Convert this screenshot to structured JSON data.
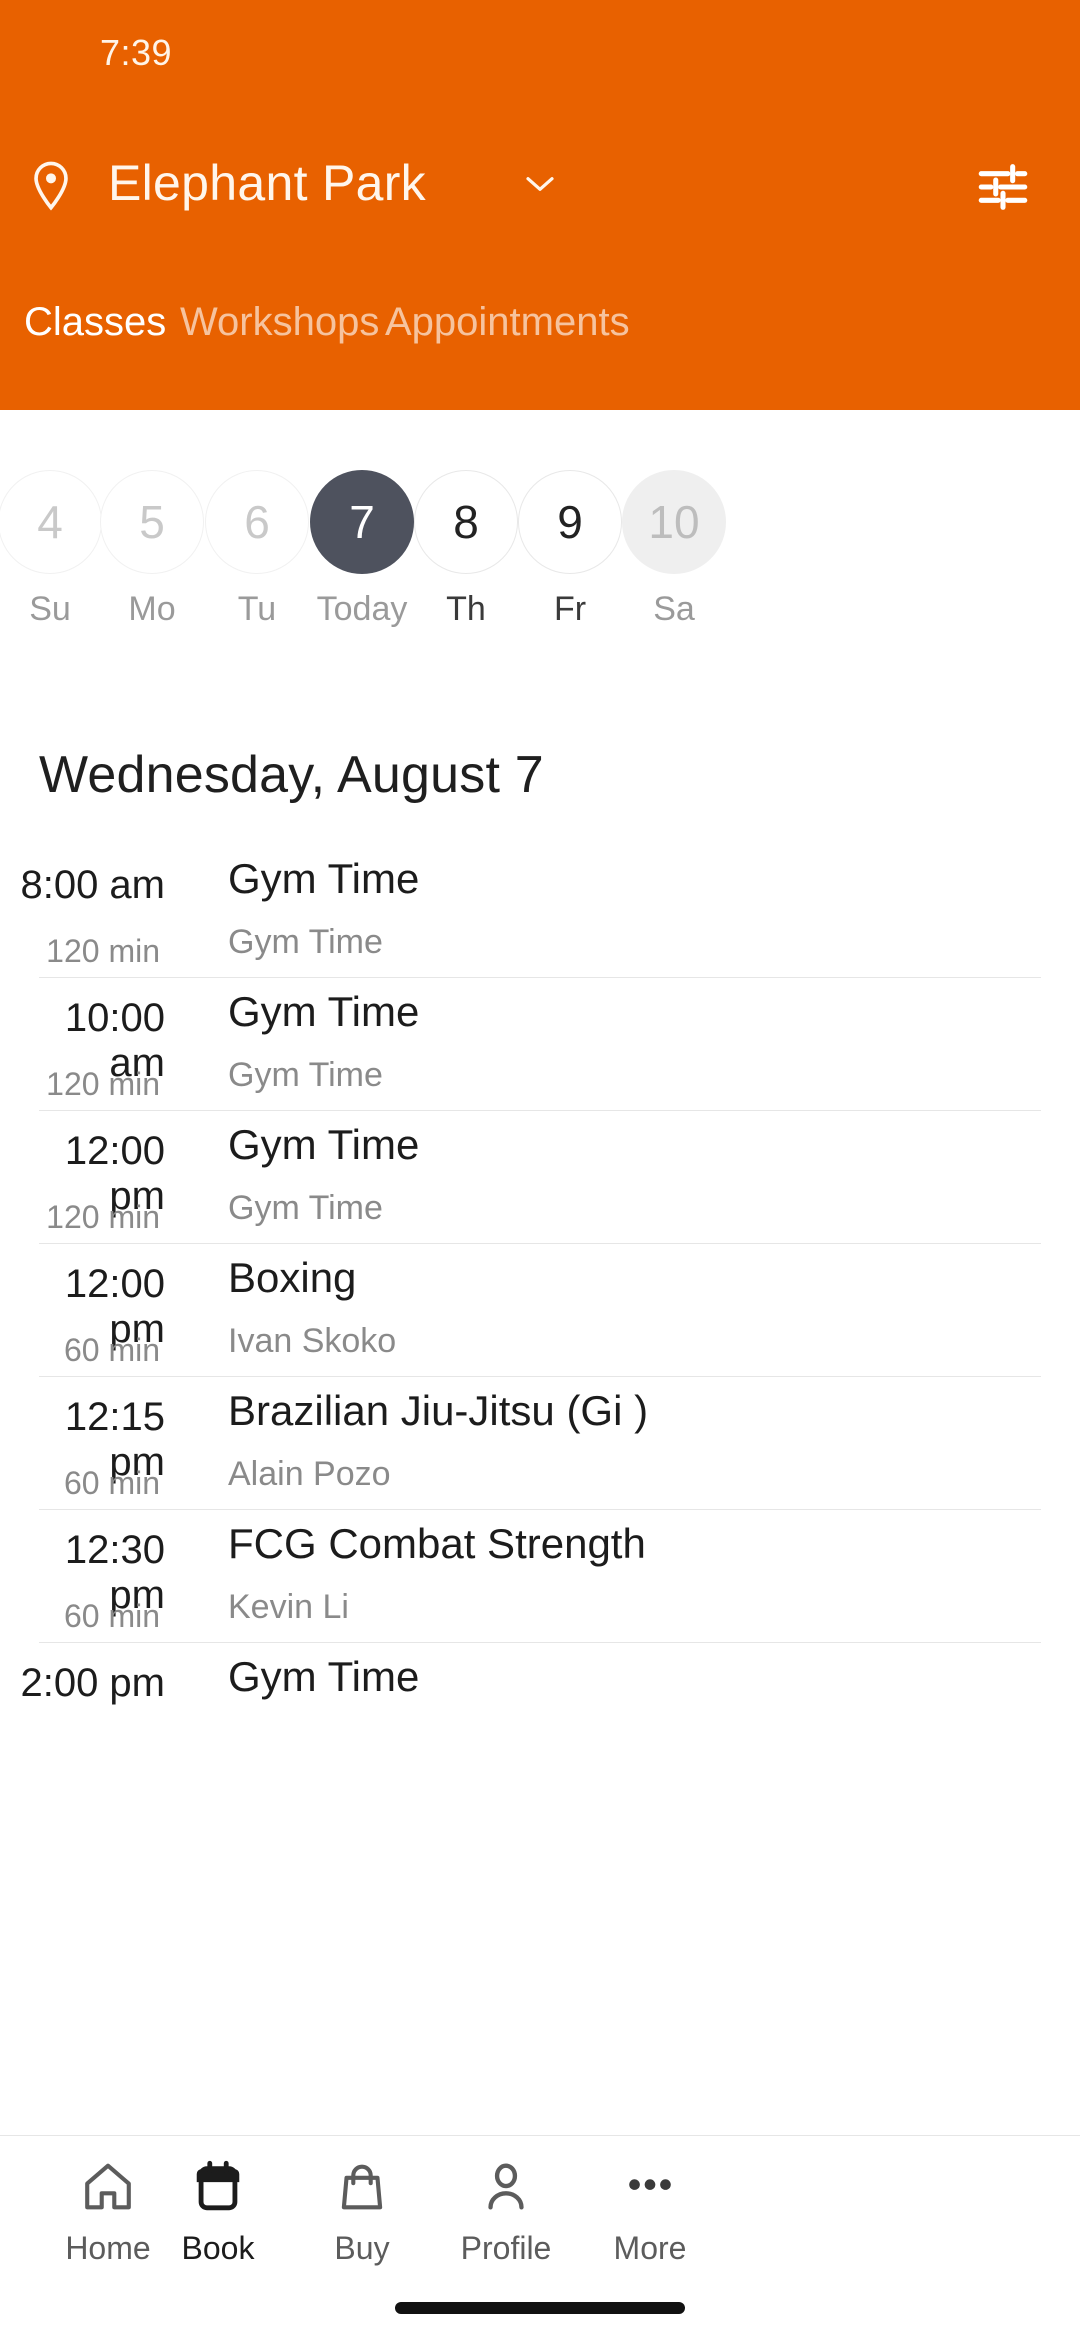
{
  "status_bar": {
    "time": "7:39"
  },
  "header": {
    "location_icon": "location-pin-icon",
    "location_name": "Elephant Park",
    "chevron_icon": "chevron-down-icon",
    "filter_icon": "filter-sliders-icon",
    "accent_color": "#E86100",
    "tabs": [
      {
        "label": "Classes",
        "active": true
      },
      {
        "label": "Workshops",
        "active": false
      },
      {
        "label": "Appointments",
        "active": false
      }
    ]
  },
  "date_strip": {
    "selected_color": "#4E525E",
    "days": [
      {
        "date": "4",
        "weekday": "Su",
        "state": "past"
      },
      {
        "date": "5",
        "weekday": "Mo",
        "state": "past"
      },
      {
        "date": "6",
        "weekday": "Tu",
        "state": "past"
      },
      {
        "date": "7",
        "weekday": "Today",
        "state": "today"
      },
      {
        "date": "8",
        "weekday": "Th",
        "state": "active"
      },
      {
        "date": "9",
        "weekday": "Fr",
        "state": "active"
      },
      {
        "date": "10",
        "weekday": "Sa",
        "state": "muted"
      }
    ]
  },
  "day_heading": "Wednesday, August 7",
  "schedule": [
    {
      "time": "8:00 am",
      "duration": "120 min",
      "title": "Gym Time",
      "instructor": "Gym Time"
    },
    {
      "time": "10:00 am",
      "duration": "120 min",
      "title": "Gym Time",
      "instructor": "Gym Time"
    },
    {
      "time": "12:00 pm",
      "duration": "120 min",
      "title": "Gym Time",
      "instructor": "Gym Time"
    },
    {
      "time": "12:00 pm",
      "duration": "60 min",
      "title": "Boxing",
      "instructor": "Ivan Skoko"
    },
    {
      "time": "12:15 pm",
      "duration": "60 min",
      "title": "Brazilian Jiu-Jitsu (Gi )",
      "instructor": "Alain Pozo"
    },
    {
      "time": "12:30 pm",
      "duration": "60 min",
      "title": "FCG Combat Strength",
      "instructor": "Kevin Li"
    },
    {
      "time": "2:00 pm",
      "duration": "",
      "title": "Gym Time",
      "instructor": ""
    }
  ],
  "bottom_nav": [
    {
      "label": "Home",
      "icon": "home-icon",
      "active": false
    },
    {
      "label": "Book",
      "icon": "calendar-icon",
      "active": true
    },
    {
      "label": "Buy",
      "icon": "bag-icon",
      "active": false
    },
    {
      "label": "Profile",
      "icon": "person-icon",
      "active": false
    },
    {
      "label": "More",
      "icon": "more-dots-icon",
      "active": false
    }
  ]
}
